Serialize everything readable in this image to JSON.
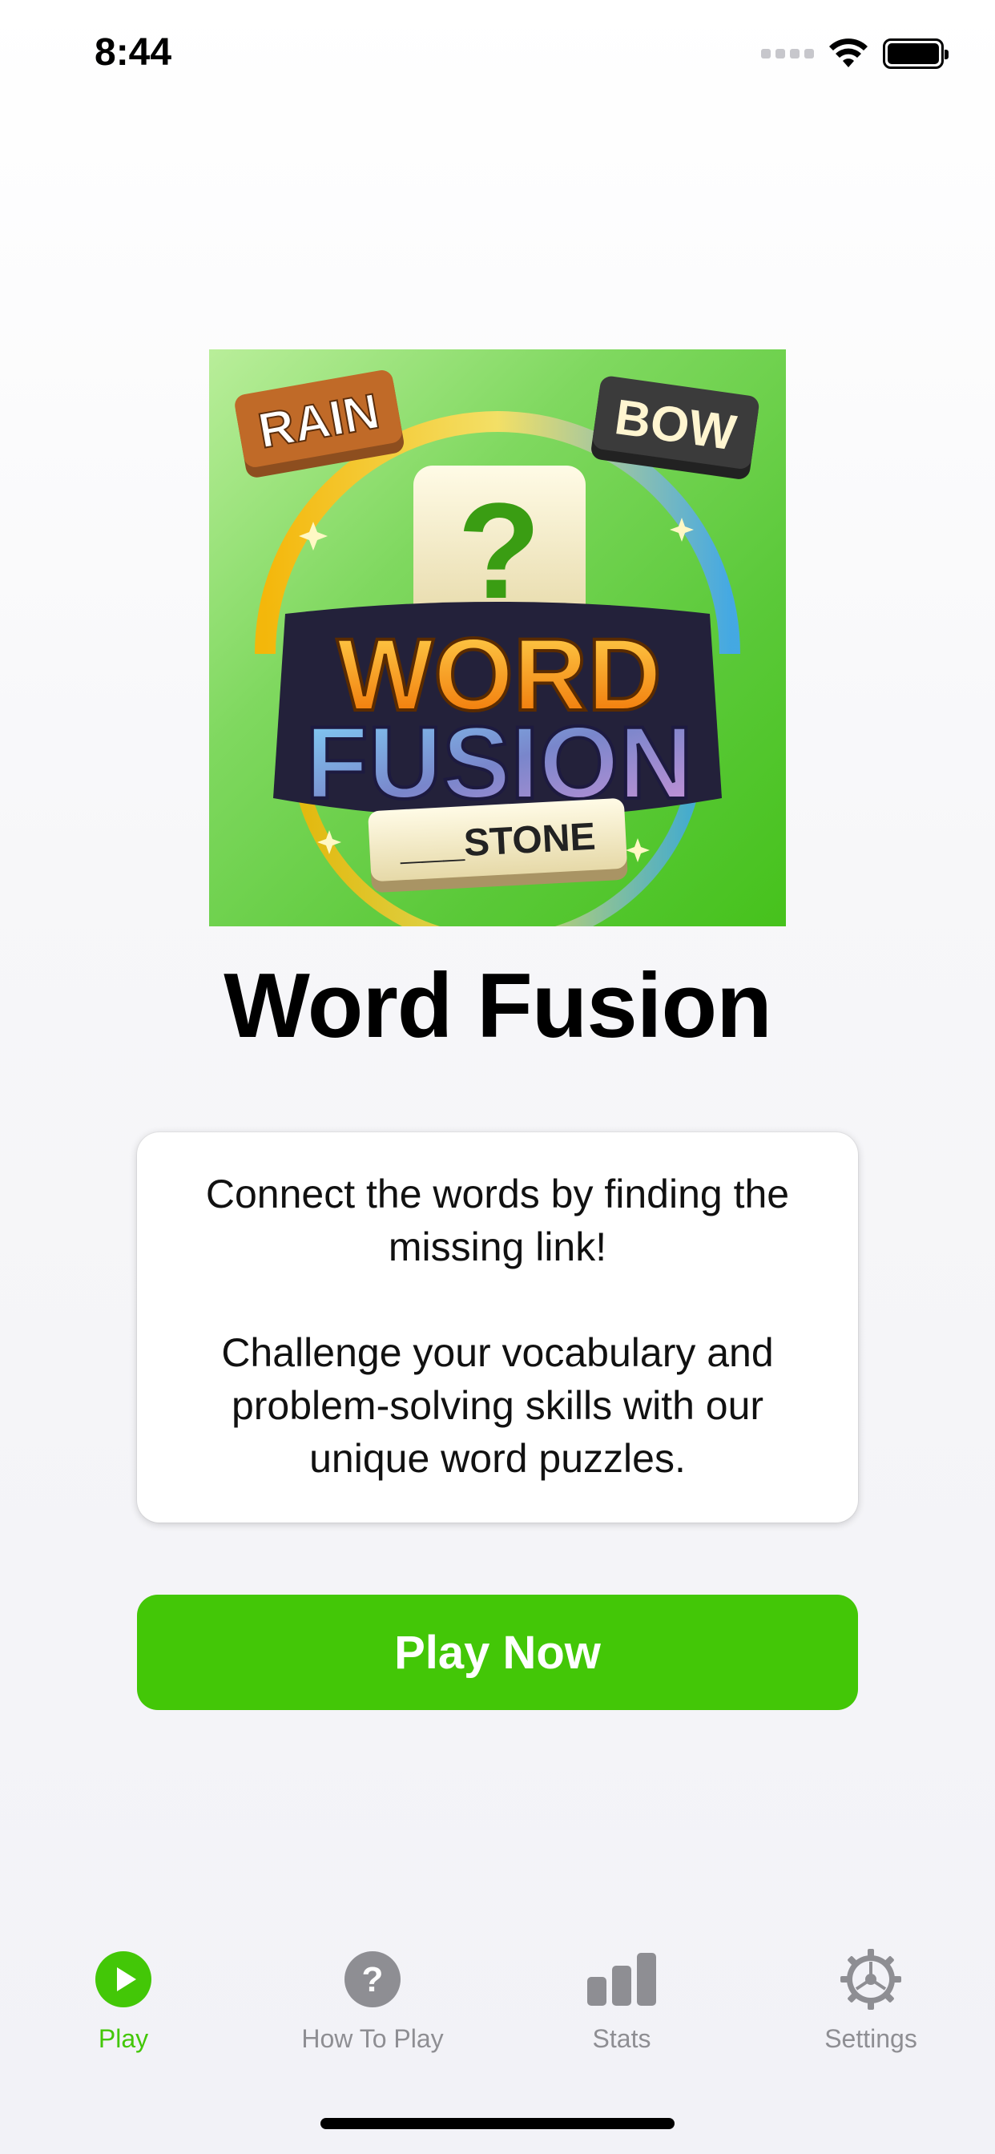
{
  "status_bar": {
    "time": "8:44",
    "icons": [
      "cellular-dots-icon",
      "wifi-icon",
      "battery-icon"
    ]
  },
  "hero": {
    "image_text": {
      "tile_left": "RAIN",
      "tile_right": "BOW",
      "center_tile": "?",
      "logo_line1": "WORD",
      "logo_line2": "FUSION",
      "bottom_tile": "___STONE"
    }
  },
  "app_title": "Word Fusion",
  "description": {
    "paragraph1": "Connect the words by finding the missing link!",
    "paragraph2": "Challenge your vocabulary and problem-solving skills with our unique word puzzles."
  },
  "play_button_label": "Play Now",
  "tabs": [
    {
      "label": "Play",
      "icon": "play-circle-icon",
      "active": true
    },
    {
      "label": "How To Play",
      "icon": "question-circle-icon",
      "active": false
    },
    {
      "label": "Stats",
      "icon": "bar-chart-icon",
      "active": false
    },
    {
      "label": "Settings",
      "icon": "gear-icon",
      "active": false
    }
  ],
  "colors": {
    "accent": "#43c707",
    "inactive": "#8e8e93",
    "hero_bg": "#5bc939"
  }
}
